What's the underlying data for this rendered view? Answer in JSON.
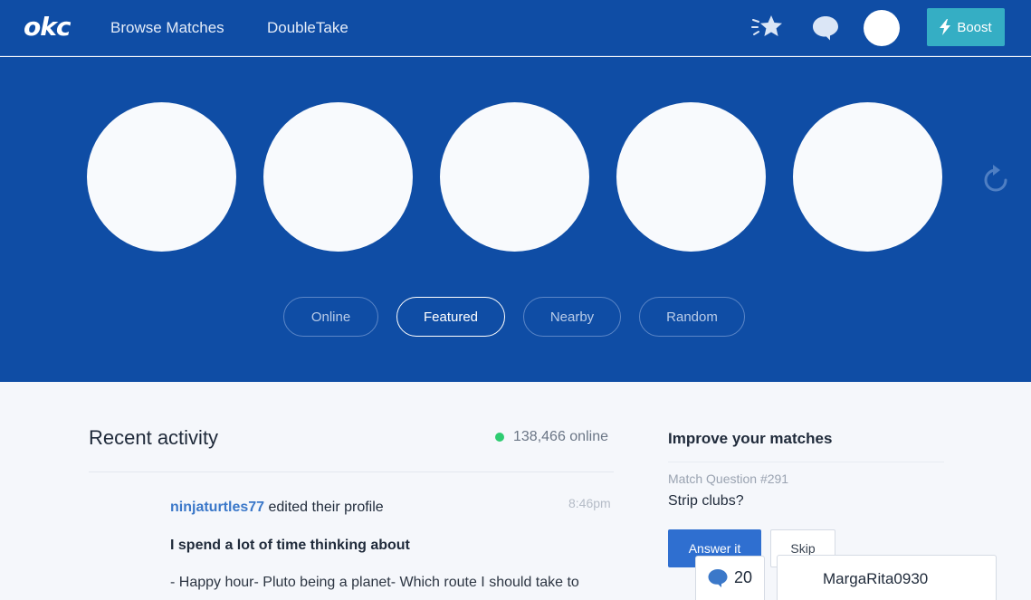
{
  "header": {
    "logo_text": "okc",
    "nav": [
      {
        "label": "Browse Matches"
      },
      {
        "label": "DoubleTake"
      }
    ],
    "icons": [
      "star-icon",
      "chat-bubble-icon"
    ],
    "boost_label": "Boost"
  },
  "hero": {
    "filters": [
      {
        "label": "Online",
        "active": false
      },
      {
        "label": "Featured",
        "active": true
      },
      {
        "label": "Nearby",
        "active": false
      },
      {
        "label": "Random",
        "active": false
      }
    ]
  },
  "activity": {
    "title": "Recent activity",
    "online_count": "138,466 online",
    "item": {
      "username": "ninjaturtles77",
      "action": " edited their profile",
      "time": "8:46pm",
      "heading": "I spend a lot of time thinking about",
      "body": "- Happy hour- Pluto being a planet- Which route I should take to"
    }
  },
  "improve": {
    "title": "Improve your matches",
    "question_number": "Match Question #291",
    "question_text": "Strip clubs?",
    "answer_label": "Answer it",
    "skip_label": "Skip"
  },
  "chat": {
    "message_count": "20",
    "open_conversation": "MargaRita0930"
  },
  "colors": {
    "brand_blue": "#0f4da5",
    "boost_teal": "#35aec4",
    "accent_blue": "#2f6fd0",
    "online_green": "#2ecc71"
  }
}
